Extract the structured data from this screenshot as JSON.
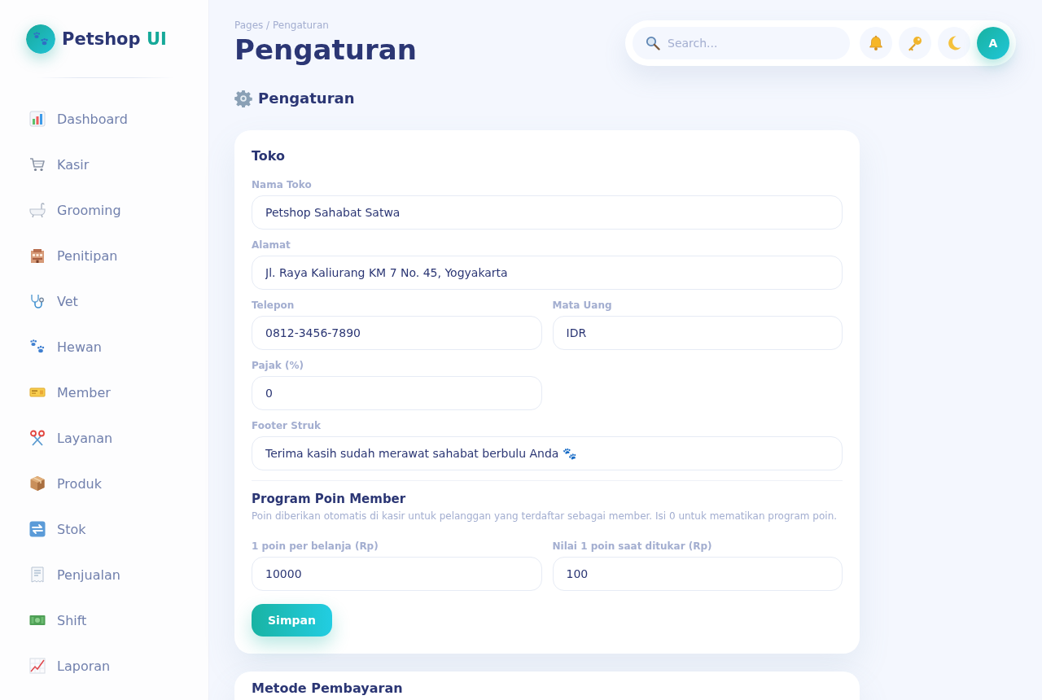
{
  "sidebar": {
    "brand": "Petshop",
    "brand_accent": "UI",
    "items": [
      {
        "label": "Dashboard",
        "selected": false
      },
      {
        "label": "Kasir",
        "selected": false
      },
      {
        "label": "Grooming",
        "selected": false
      },
      {
        "label": "Penitipan",
        "selected": false
      },
      {
        "label": "Vet",
        "selected": false
      },
      {
        "label": "Hewan",
        "selected": false
      },
      {
        "label": "Member",
        "selected": false
      },
      {
        "label": "Layanan",
        "selected": false
      },
      {
        "label": "Produk",
        "selected": false
      },
      {
        "label": "Stok",
        "selected": false
      },
      {
        "label": "Penjualan",
        "selected": false
      },
      {
        "label": "Shift",
        "selected": false
      },
      {
        "label": "Laporan",
        "selected": false
      }
    ]
  },
  "header": {
    "breadcrumb": "Pages / Pengaturan",
    "title": "Pengaturan",
    "search": {
      "placeholder": "Search..."
    },
    "avatar": "A"
  },
  "section_title": "Pengaturan",
  "settings_card": {
    "title": "Toko",
    "fields": [
      {
        "label": "Nama Toko",
        "value": "Petshop Sahabat Satwa",
        "kind": "wide"
      },
      {
        "label": "Alamat",
        "value": "Jl. Raya Kaliurang KM 7 No. 45, Yogyakarta",
        "kind": "wide"
      },
      {
        "label": "Telepon",
        "value": "0812-3456-7890",
        "kind": "narrow"
      },
      {
        "label": "Mata Uang",
        "value": "IDR",
        "kind": "narrow"
      },
      {
        "label": "Pajak (%)",
        "value": "0",
        "kind": "narrow"
      },
      {
        "label": "Footer Struk",
        "value": "Terima kasih sudah merawat sahabat berbulu Anda 🐾",
        "kind": "wide"
      }
    ],
    "points": {
      "title": "Program Poin Member",
      "description": "Poin diberikan otomatis di kasir untuk pelanggan yang terdaftar sebagai member. Isi 0 untuk mematikan program poin.",
      "fields": [
        {
          "label": "1 poin per belanja (Rp)",
          "value": "10000",
          "kind": "narrow"
        },
        {
          "label": "Nilai 1 poin saat ditukar (Rp)",
          "value": "100",
          "kind": "narrow"
        }
      ]
    },
    "save_button": "Simpan"
  },
  "next_card": {
    "title": "Metode Pembayaran"
  }
}
